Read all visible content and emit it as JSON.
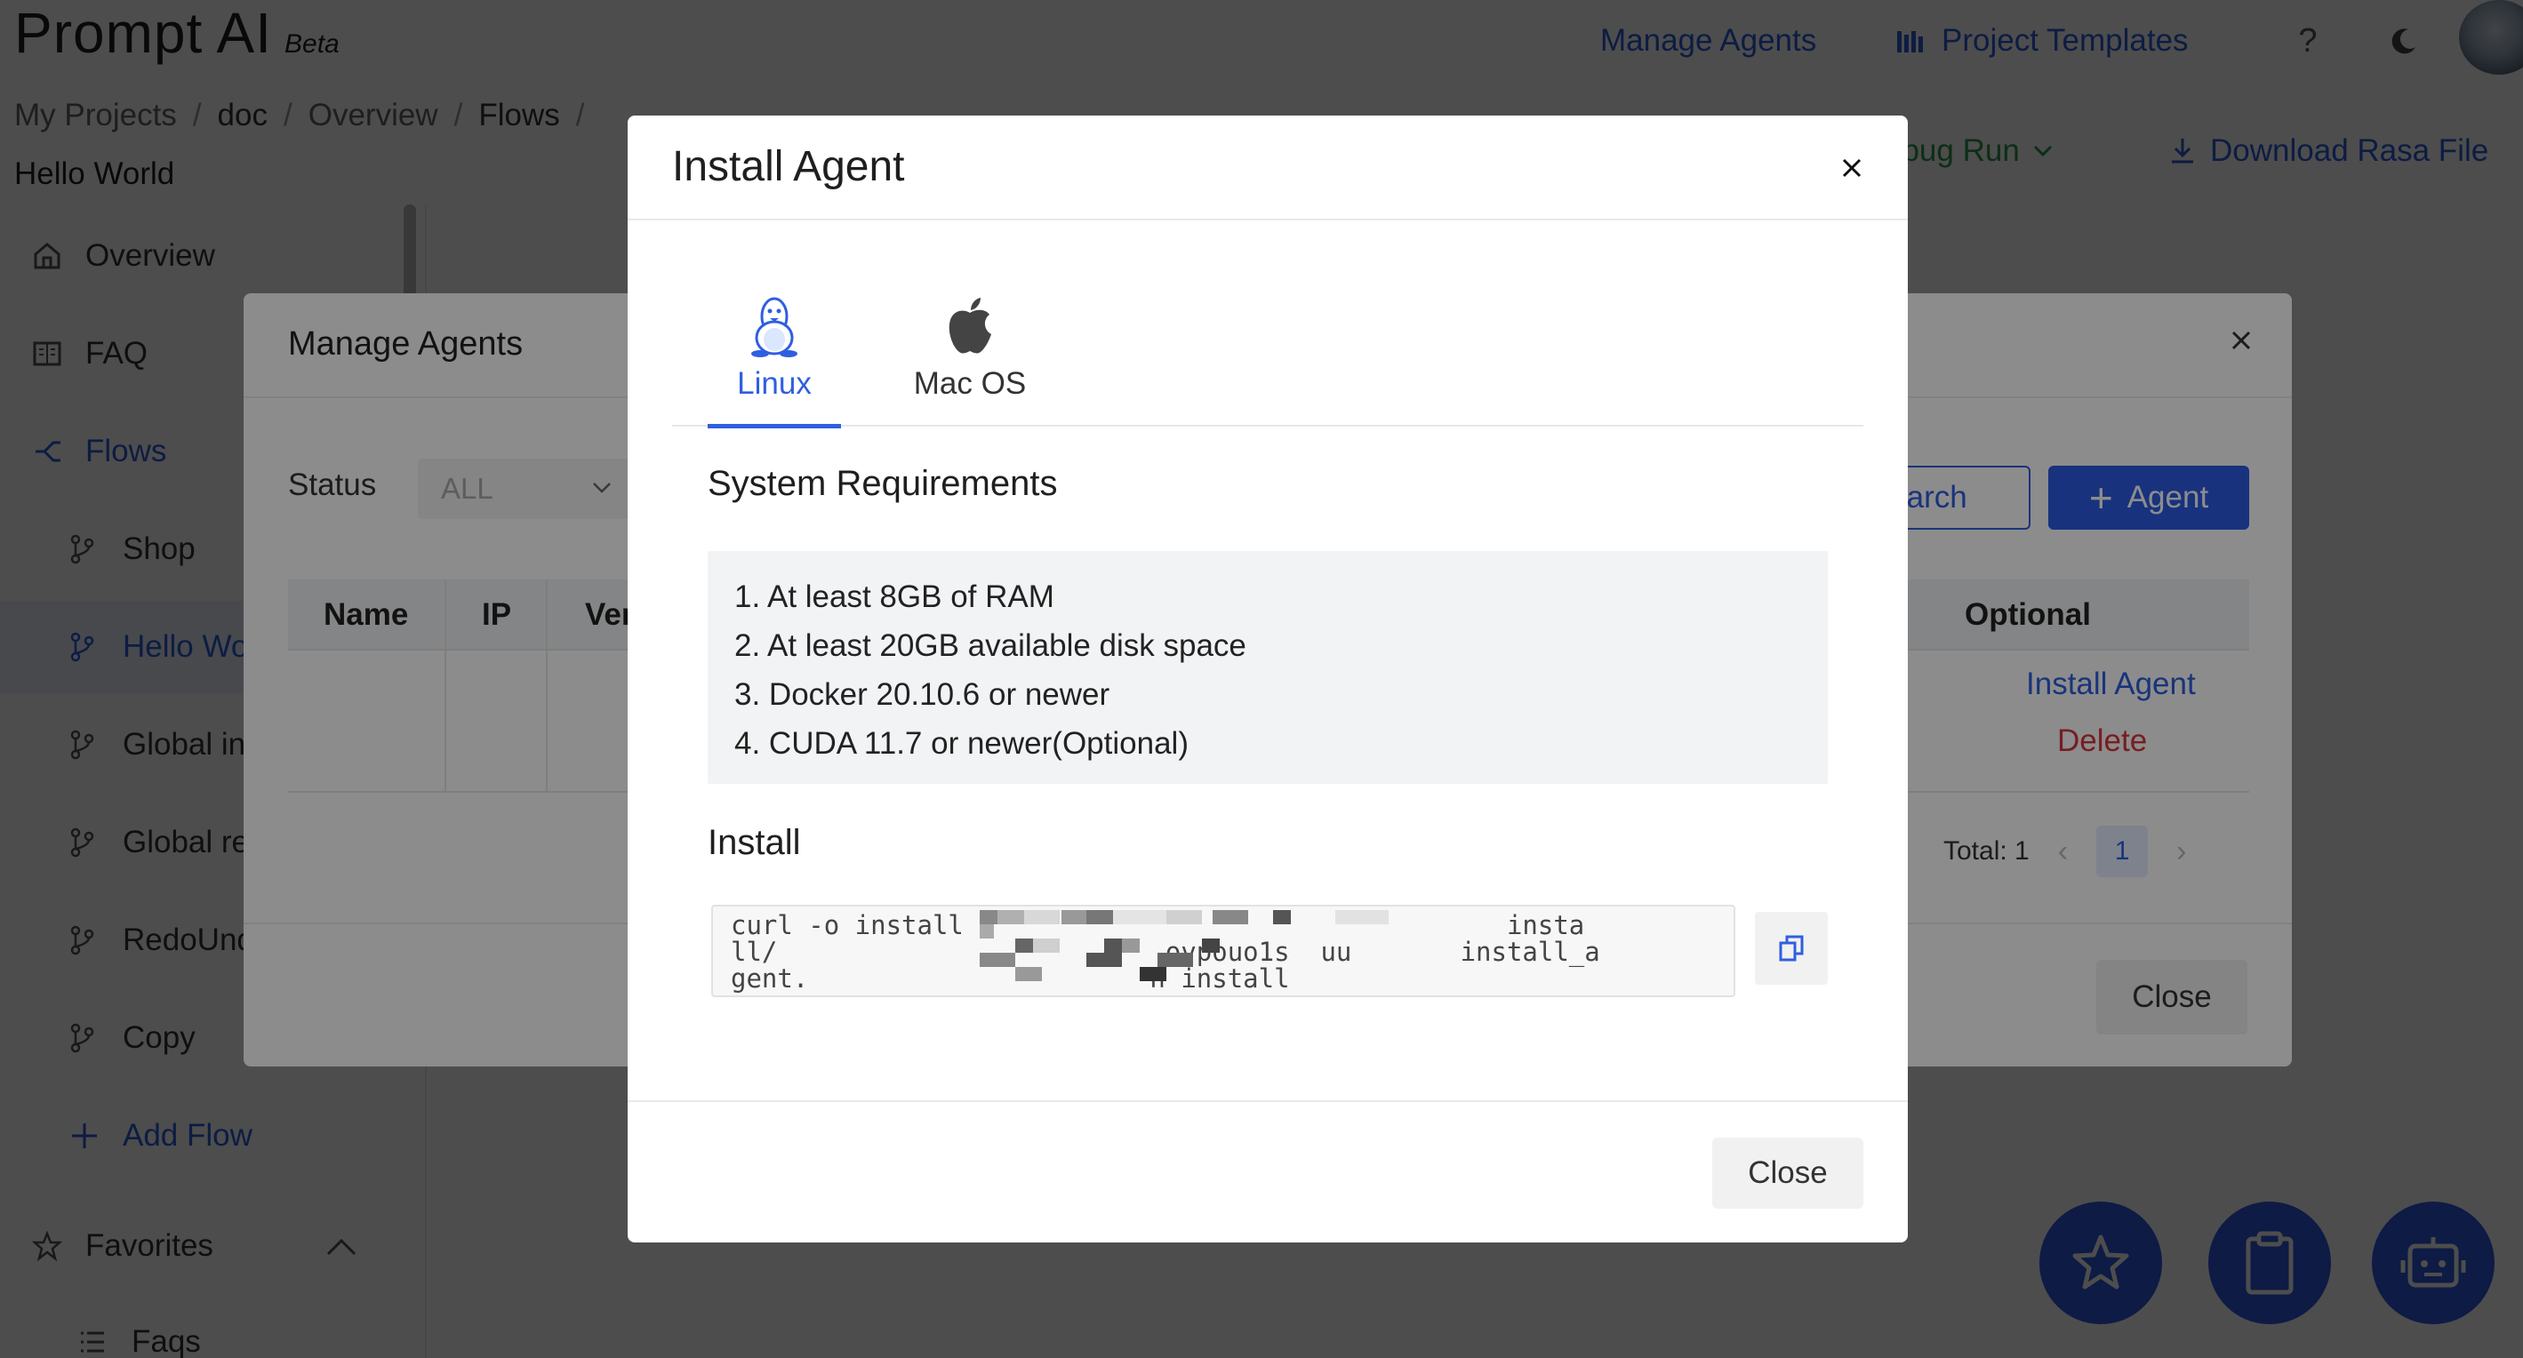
{
  "app": {
    "brand_name": "Prompt AI",
    "brand_badge": "Beta"
  },
  "top_nav": {
    "manage_agents": "Manage Agents",
    "project_templates": "Project Templates",
    "help": "?"
  },
  "breadcrumb": {
    "items": [
      "My Projects",
      "doc",
      "Overview",
      "Flows"
    ],
    "separator": "/",
    "page_subtitle": "Hello World"
  },
  "actions": {
    "debug_run": "ebug Run",
    "download": "Download Rasa File"
  },
  "sidebar": {
    "overview": "Overview",
    "faq": "FAQ",
    "flows": "Flows",
    "flow_items": [
      "Shop",
      "Hello Wo",
      "Global in",
      "Global re",
      "RedoUnd",
      "Copy"
    ],
    "add_flow": "Add Flow",
    "favorites": "Favorites",
    "faqs": "Faqs"
  },
  "manage_agents_modal": {
    "title": "Manage Agents",
    "status_label": "Status",
    "status_value": "ALL",
    "search_label": "earch",
    "add_label": "Agent",
    "columns": [
      "Name",
      "IP",
      "Ver",
      "Optional"
    ],
    "install_link": "Install Agent",
    "delete_link": "Delete",
    "total_label": "Total: 1",
    "current_page": "1",
    "close_label": "Close"
  },
  "install_agent_modal": {
    "title": "Install Agent",
    "tabs": [
      {
        "label": "Linux",
        "icon": "linux-penguin-icon",
        "active": true
      },
      {
        "label": "Mac OS",
        "icon": "apple-icon",
        "active": false
      }
    ],
    "requirements_title": "System Requirements",
    "requirements": [
      "1. At least 8GB of RAM",
      "2. At least 20GB available disk space",
      "3. Docker 20.10.6 or newer",
      "4. CUDA 11.7 or newer(Optional)"
    ],
    "install_title": "Install",
    "install_command": "curl -o install                                   insta\nll/                         ovpouo1s  uu       install_a\ngent.                      h install",
    "close_label": "Close"
  },
  "colors": {
    "accent": "#2f5fe0",
    "fab": "#2c5ce6",
    "danger": "#d9363e",
    "success": "#2e9a4b"
  }
}
